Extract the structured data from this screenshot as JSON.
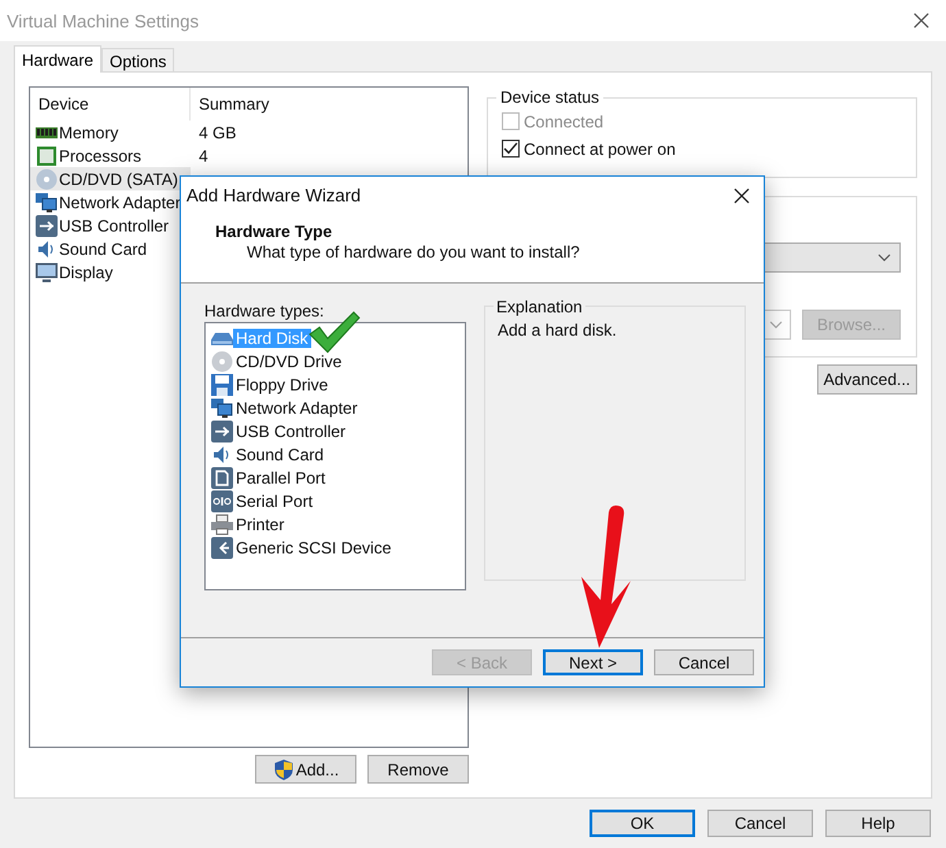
{
  "window": {
    "title": "Virtual Machine Settings"
  },
  "tabs": [
    {
      "label": "Hardware",
      "selected": true
    },
    {
      "label": "Options",
      "selected": false
    }
  ],
  "device_table": {
    "columns": [
      "Device",
      "Summary"
    ],
    "rows": [
      {
        "kind": "memory",
        "device": "Memory",
        "summary": "4 GB",
        "selected": false
      },
      {
        "kind": "processor",
        "device": "Processors",
        "summary": "4",
        "selected": false
      },
      {
        "kind": "cd",
        "device": "CD/DVD (SATA)",
        "selected": true
      },
      {
        "kind": "network",
        "device": "Network Adapter",
        "selected": false
      },
      {
        "kind": "usb",
        "device": "USB Controller",
        "selected": false
      },
      {
        "kind": "sound",
        "device": "Sound Card",
        "selected": false
      },
      {
        "kind": "display",
        "device": "Display",
        "selected": false
      }
    ]
  },
  "device_buttons": [
    {
      "label": "Add...",
      "shield": true
    },
    {
      "label": "Remove",
      "shield": false
    }
  ],
  "device_status": {
    "title": "Device status",
    "options": [
      {
        "label": "Connected",
        "checked": false,
        "disabled": true
      },
      {
        "label": "Connect at power on",
        "checked": true,
        "disabled": false
      }
    ]
  },
  "connection": {
    "browse_button": {
      "label": "Browse...",
      "disabled": true
    },
    "advanced_button": {
      "label": "Advanced...",
      "disabled": false
    }
  },
  "footer_buttons": [
    {
      "label": "OK",
      "default": true
    },
    {
      "label": "Cancel",
      "default": false
    },
    {
      "label": "Help",
      "default": false
    }
  ],
  "wizard": {
    "title": "Add Hardware Wizard",
    "heading": "Hardware Type",
    "subheading": "What type of hardware do you want to install?",
    "list_label": "Hardware types:",
    "items": [
      {
        "kind": "disk",
        "label": "Hard Disk",
        "selected": true
      },
      {
        "kind": "cd",
        "label": "CD/DVD Drive",
        "selected": false
      },
      {
        "kind": "floppy",
        "label": "Floppy Drive",
        "selected": false
      },
      {
        "kind": "network",
        "label": "Network Adapter",
        "selected": false
      },
      {
        "kind": "usb",
        "label": "USB Controller",
        "selected": false
      },
      {
        "kind": "sound",
        "label": "Sound Card",
        "selected": false
      },
      {
        "kind": "parallel",
        "label": "Parallel Port",
        "selected": false
      },
      {
        "kind": "serial",
        "label": "Serial Port",
        "selected": false
      },
      {
        "kind": "printer",
        "label": "Printer",
        "selected": false
      },
      {
        "kind": "scsi",
        "label": "Generic SCSI Device",
        "selected": false
      }
    ],
    "explanation_title": "Explanation",
    "explanation": "Add a hard disk.",
    "buttons": [
      {
        "label": "< Back",
        "disabled": true,
        "default": false
      },
      {
        "label": "Next >",
        "disabled": false,
        "default": true
      },
      {
        "label": "Cancel",
        "disabled": false,
        "default": false
      }
    ]
  }
}
